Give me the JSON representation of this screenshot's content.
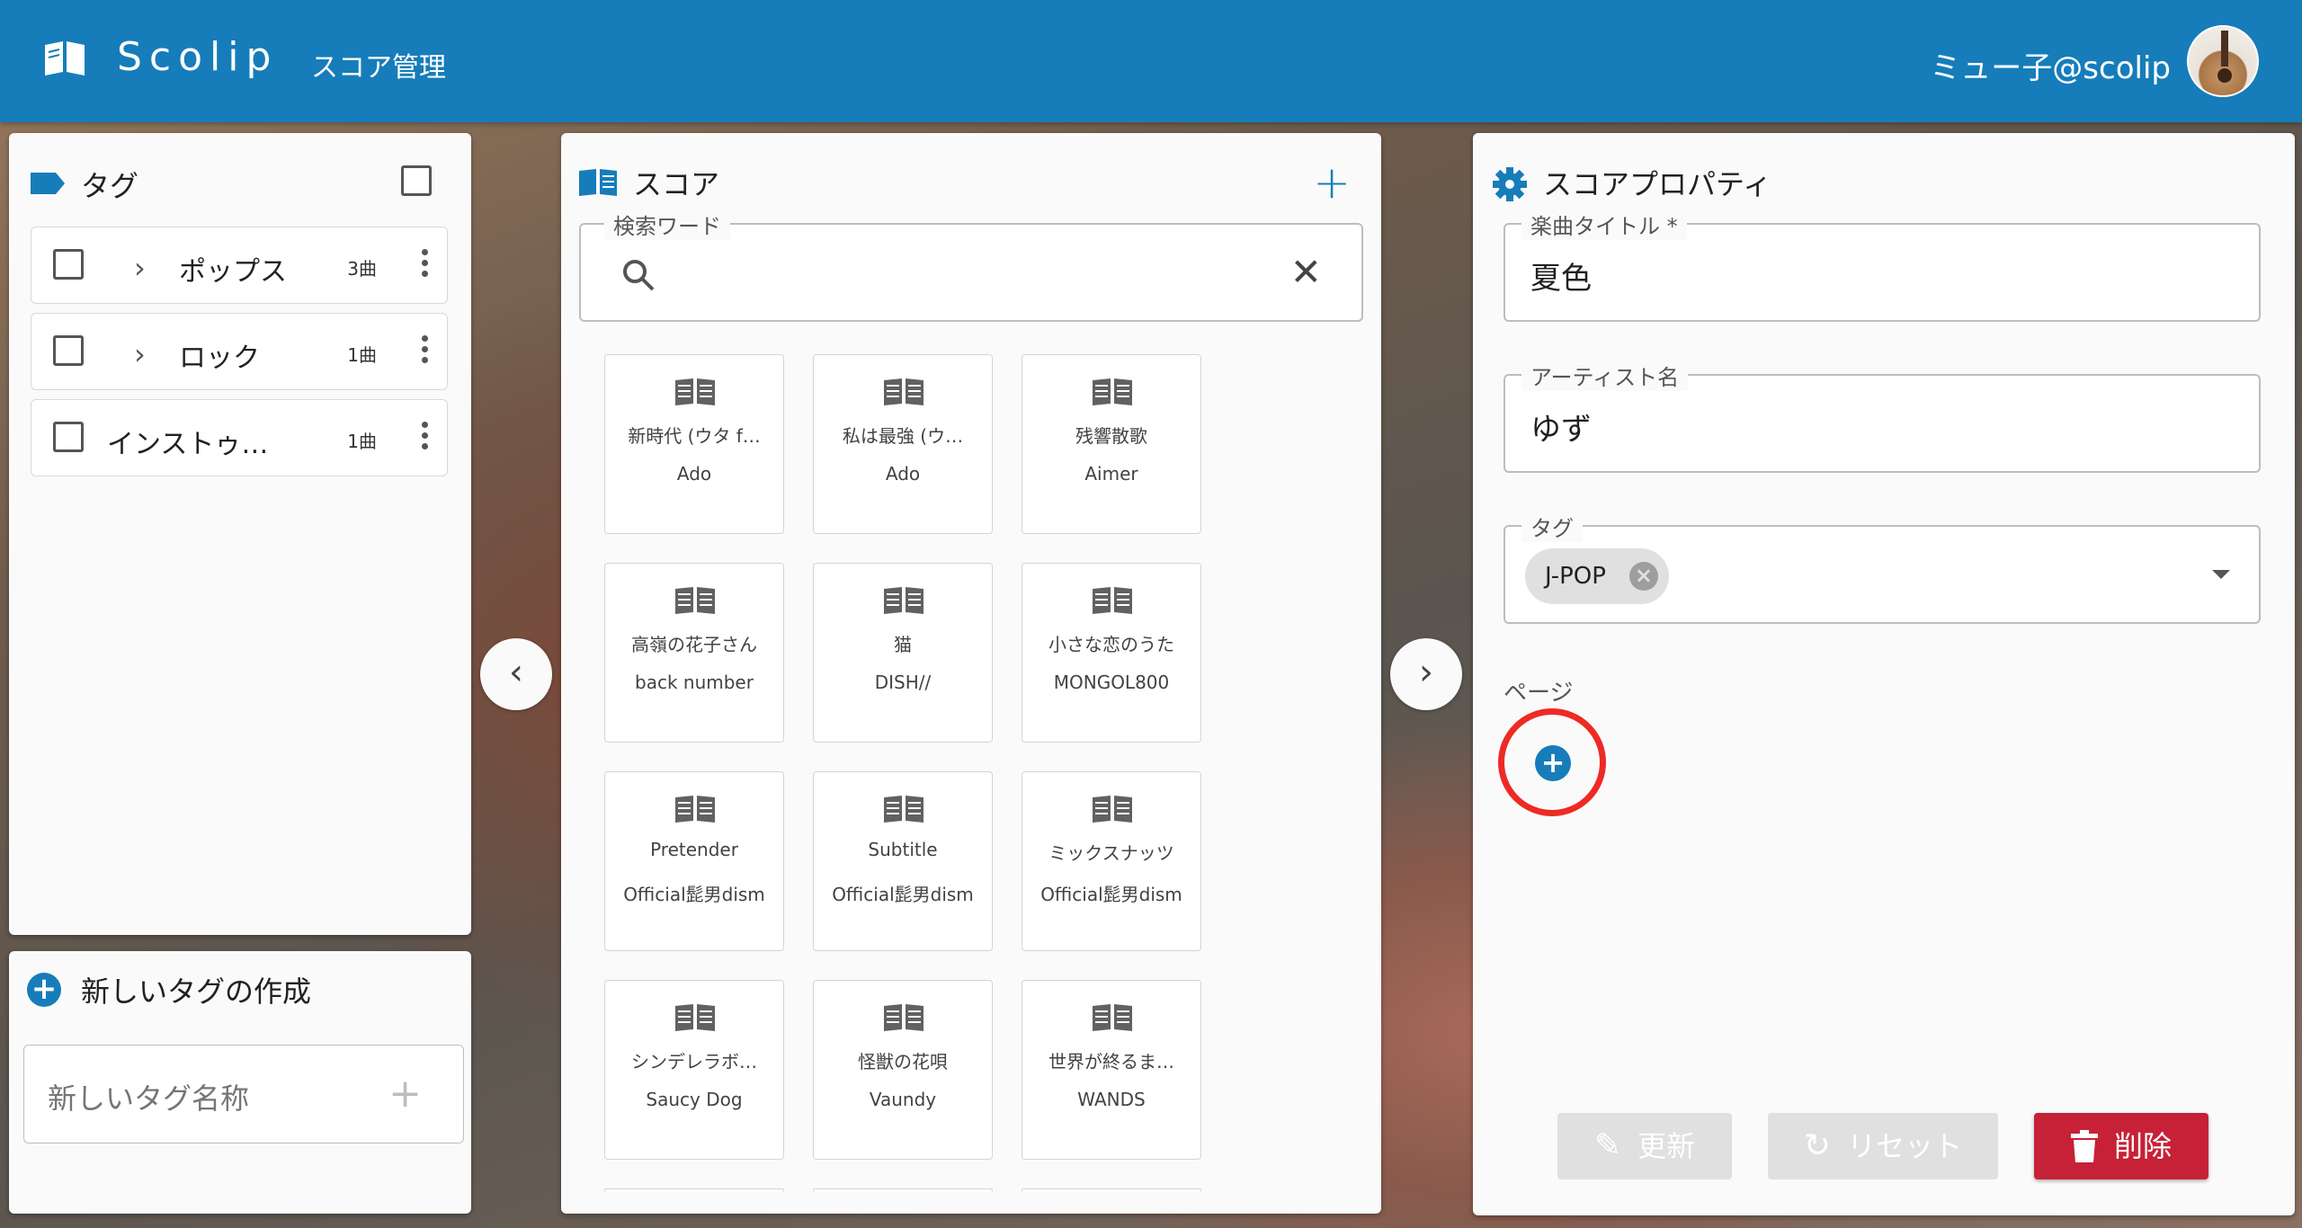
{
  "header": {
    "brand": "Scolip",
    "nav_link": "スコア管理",
    "username": "ミュー子@scolip"
  },
  "tags_panel": {
    "title": "タグ",
    "items": [
      {
        "name": "ポップス",
        "count": "3曲"
      },
      {
        "name": "ロック",
        "count": "1曲"
      },
      {
        "name": "インストゥ…",
        "count": "1曲"
      }
    ]
  },
  "new_tag_panel": {
    "title": "新しいタグの作成",
    "placeholder": "新しいタグ名称"
  },
  "score_panel": {
    "title": "スコア",
    "search_label": "検索ワード",
    "cards": [
      {
        "title": "新時代 (ウタ f…",
        "artist": "Ado"
      },
      {
        "title": "私は最強 (ウ…",
        "artist": "Ado"
      },
      {
        "title": "残響散歌",
        "artist": "Aimer"
      },
      {
        "title": "高嶺の花子さん",
        "artist": "back number"
      },
      {
        "title": "猫",
        "artist": "DISH//"
      },
      {
        "title": "小さな恋のうた",
        "artist": "MONGOL800"
      },
      {
        "title": "Pretender",
        "artist": "Official髭男dism"
      },
      {
        "title": "Subtitle",
        "artist": "Official髭男dism"
      },
      {
        "title": "ミックスナッツ",
        "artist": "Official髭男dism"
      },
      {
        "title": "シンデレラボ…",
        "artist": "Saucy Dog"
      },
      {
        "title": "怪獣の花唄",
        "artist": "Vaundy"
      },
      {
        "title": "世界が終るま…",
        "artist": "WANDS"
      }
    ]
  },
  "property_panel": {
    "title": "スコアプロパティ",
    "song_title_label": "楽曲タイトル *",
    "song_title_value": "夏色",
    "artist_label": "アーティスト名",
    "artist_value": "ゆず",
    "tag_label": "タグ",
    "tag_chip": "J-POP",
    "page_label": "ページ",
    "update_label": "更新",
    "reset_label": "リセット",
    "delete_label": "削除"
  },
  "colors": {
    "primary": "#167dba",
    "danger": "#c62137",
    "highlight_ring": "#ee2a24"
  }
}
